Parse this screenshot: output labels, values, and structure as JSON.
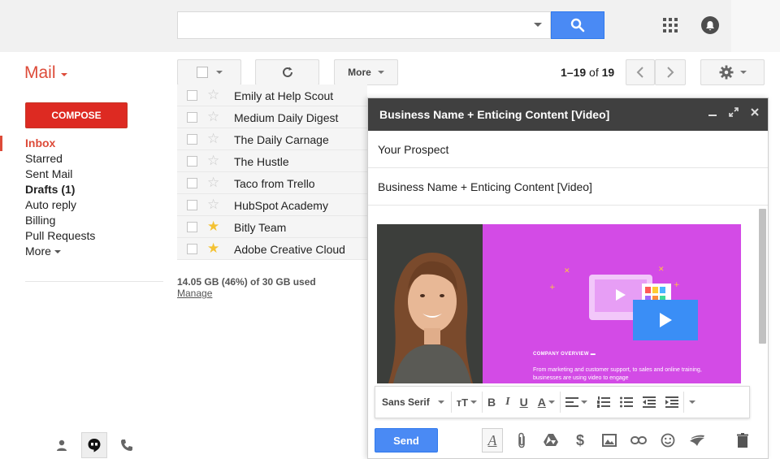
{
  "search": {
    "placeholder": "",
    "value": ""
  },
  "header": {
    "app_label": "Mail"
  },
  "toolbar": {
    "more_label": "More",
    "page_range": "1–19",
    "page_of": "of",
    "page_total": "19"
  },
  "nav": {
    "compose_label": "COMPOSE",
    "items": [
      {
        "label": "Inbox"
      },
      {
        "label": "Starred"
      },
      {
        "label": "Sent Mail"
      },
      {
        "label": "Drafts (1)"
      },
      {
        "label": "Auto reply"
      },
      {
        "label": "Billing"
      },
      {
        "label": "Pull Requests"
      },
      {
        "label": "More"
      }
    ]
  },
  "messages": [
    {
      "sender": "Emily at Help Scout",
      "starred": false
    },
    {
      "sender": "Medium Daily Digest",
      "starred": false
    },
    {
      "sender": "The Daily Carnage",
      "starred": false
    },
    {
      "sender": "The Hustle",
      "starred": false
    },
    {
      "sender": "Taco from Trello",
      "starred": false
    },
    {
      "sender": "HubSpot Academy",
      "starred": false
    },
    {
      "sender": "Bitly Team",
      "starred": true
    },
    {
      "sender": "Adobe Creative Cloud",
      "starred": true
    }
  ],
  "storage": {
    "usage": "14.05 GB (46%) of 30 GB used",
    "manage_label": "Manage"
  },
  "compose": {
    "title": "Business Name + Enticing Content [Video]",
    "to": "Your Prospect",
    "subject": "Business Name + Enticing Content  [Video]",
    "video_heading": "COMPANY OVERVIEW",
    "video_text": "From marketing and customer support, to sales and online training, businesses are using video to engage",
    "font_name": "Sans Serif",
    "send_label": "Send"
  },
  "colors": {
    "accent_red": "#dd4b39",
    "compose_red": "#dd2a22",
    "primary_blue": "#4a8af4",
    "header_dark": "#404040",
    "video_magenta": "#d34be6",
    "star_gold": "#f4c233"
  }
}
